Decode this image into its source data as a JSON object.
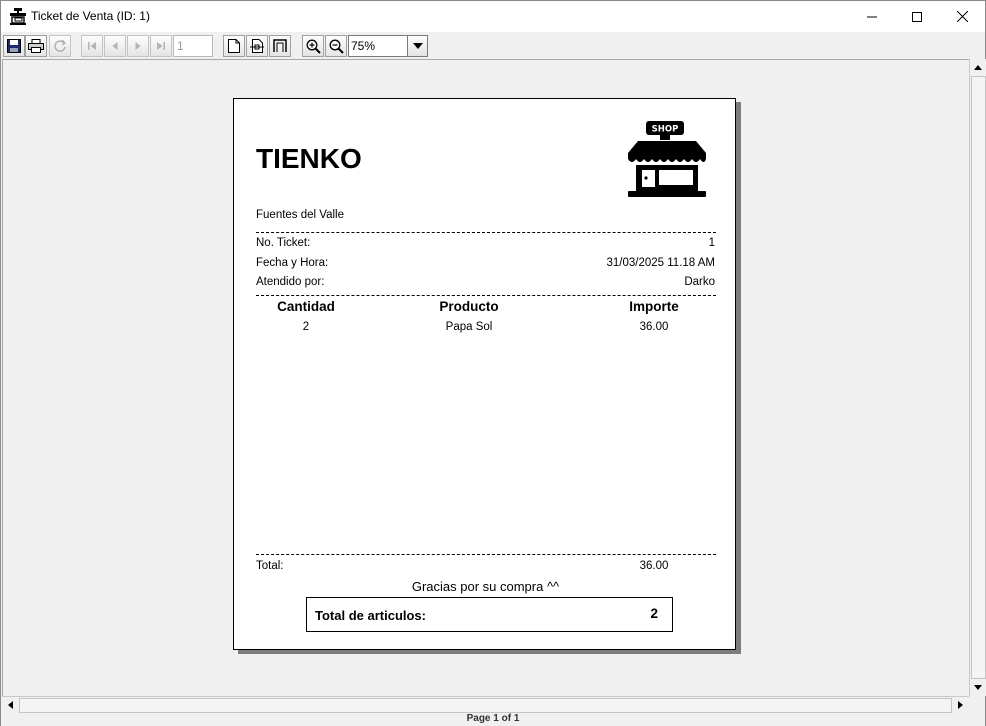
{
  "window": {
    "title": "Ticket de Venta (ID: 1)",
    "minimize_icon": "minimize-icon",
    "maximize_icon": "maximize-icon",
    "close_icon": "close-icon"
  },
  "toolbar": {
    "buttons": [
      "save-icon",
      "print-icon",
      "reload-icon",
      "first-page-icon",
      "previous-page-icon",
      "next-page-icon",
      "last-page-icon",
      "actual-size-icon",
      "fit-width-icon",
      "fit-page-icon",
      "zoom-in-icon",
      "zoom-out-icon"
    ],
    "page_number": "1",
    "zoom": "75%"
  },
  "ticket": {
    "store_name": "TIENKO",
    "logo_text": "SHOP",
    "branch": "Fuentes del Valle",
    "ticket_label": "No. Ticket:",
    "ticket_value": "1",
    "datetime_label": "Fecha y Hora:",
    "datetime_value": "31/03/2025 11.18 AM",
    "attended_label": "Atendido por:",
    "attended_value": "Darko",
    "columns": [
      "Cantidad",
      "Producto",
      "Importe"
    ],
    "items": [
      {
        "cantidad": "2",
        "producto": "Papa Sol",
        "importe": "36.00"
      }
    ],
    "total_label": "Total:",
    "total_value": "36.00",
    "thanks": "Gracias por su compra ^^",
    "articles_label": "Total de articulos:",
    "articles_value": "2"
  },
  "status": {
    "page_text": "Page 1 of 1"
  },
  "colors": {
    "toolbar_bg": "#f0f0f0",
    "page_bg": "#ffffff",
    "shadow": "#7d7d7d"
  }
}
